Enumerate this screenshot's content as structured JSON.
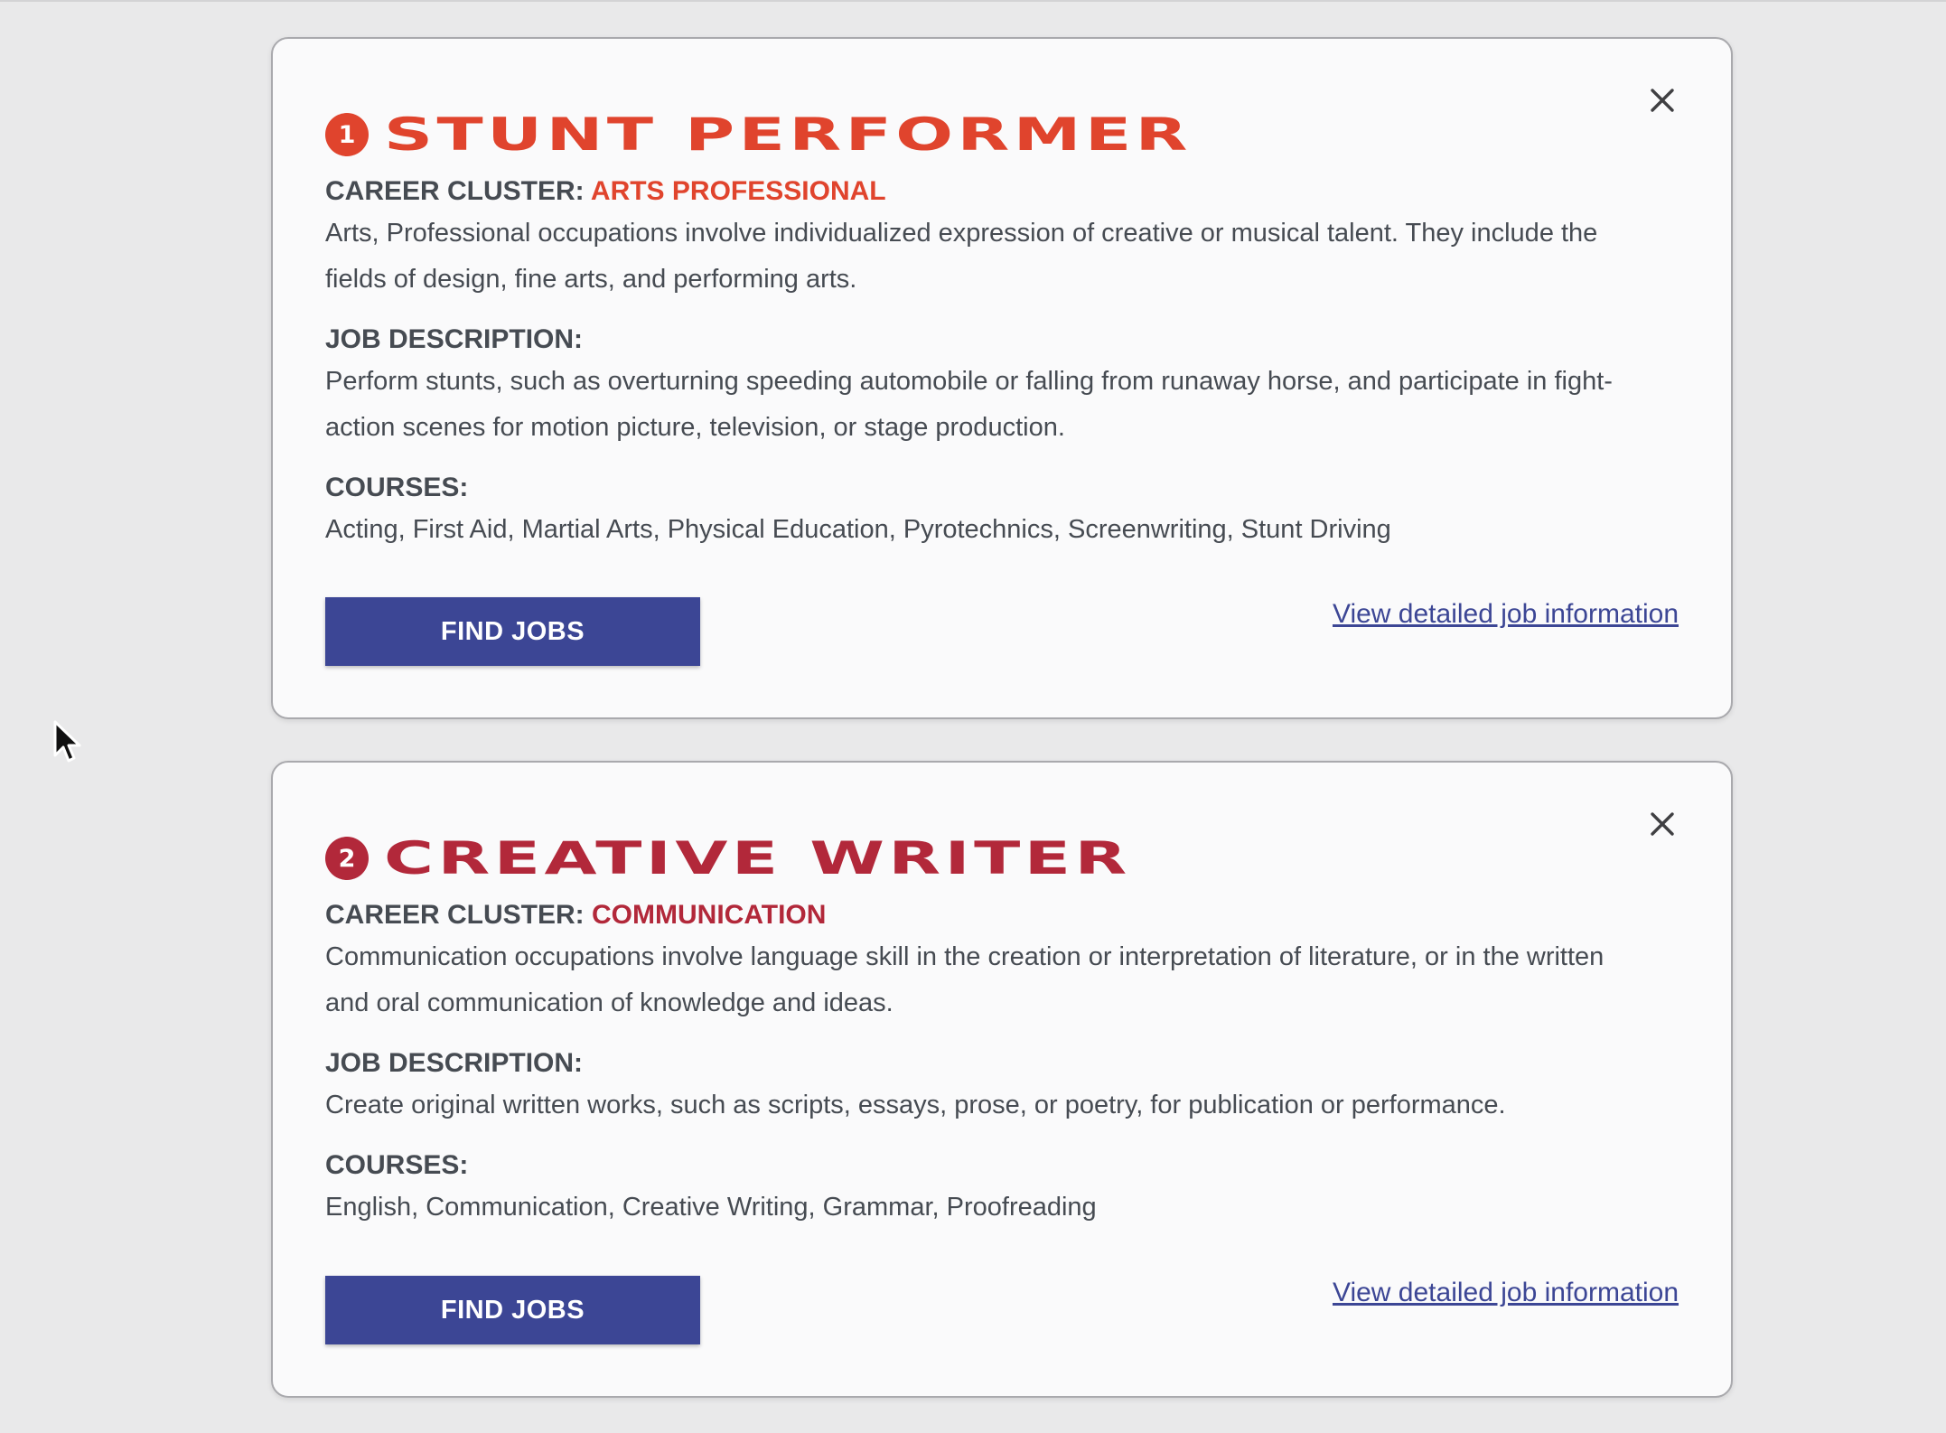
{
  "careers": [
    {
      "number": "1",
      "title": "STUNT PERFORMER",
      "accent_color": "#e0442d",
      "cluster_label": "CAREER CLUSTER:",
      "cluster_name": "ARTS PROFESSIONAL",
      "cluster_description": "Arts, Professional occupations involve individualized expression of creative or musical talent. They include the fields of design, fine arts, and performing arts.",
      "job_description_label": "JOB DESCRIPTION:",
      "job_description": "Perform stunts, such as overturning speeding automobile or falling from runaway horse, and participate in fight-action scenes for motion picture, television, or stage production.",
      "courses_label": "COURSES:",
      "courses": "Acting, First Aid, Martial Arts, Physical Education, Pyrotechnics, Screenwriting, Stunt Driving",
      "find_jobs_label": "FIND JOBS",
      "detail_link_label": "View detailed job information",
      "close_icon": "close-icon"
    },
    {
      "number": "2",
      "title": "CREATIVE WRITER",
      "accent_color": "#b2283a",
      "cluster_label": "CAREER CLUSTER:",
      "cluster_name": "COMMUNICATION",
      "cluster_description": "Communication occupations involve language skill in the creation or interpretation of literature, or in the written and oral communication of knowledge and ideas.",
      "job_description_label": "JOB DESCRIPTION:",
      "job_description": "Create original written works, such as scripts, essays, prose, or poetry, for publication or performance.",
      "courses_label": "COURSES:",
      "courses": "English, Communication, Creative Writing, Grammar, Proofreading",
      "find_jobs_label": "FIND JOBS",
      "detail_link_label": "View detailed job information",
      "close_icon": "close-icon"
    }
  ],
  "colors": {
    "page_background": "#e9e9ea",
    "card_background": "#fafafb",
    "button_blue": "#3c4695",
    "body_text": "#464b52"
  }
}
